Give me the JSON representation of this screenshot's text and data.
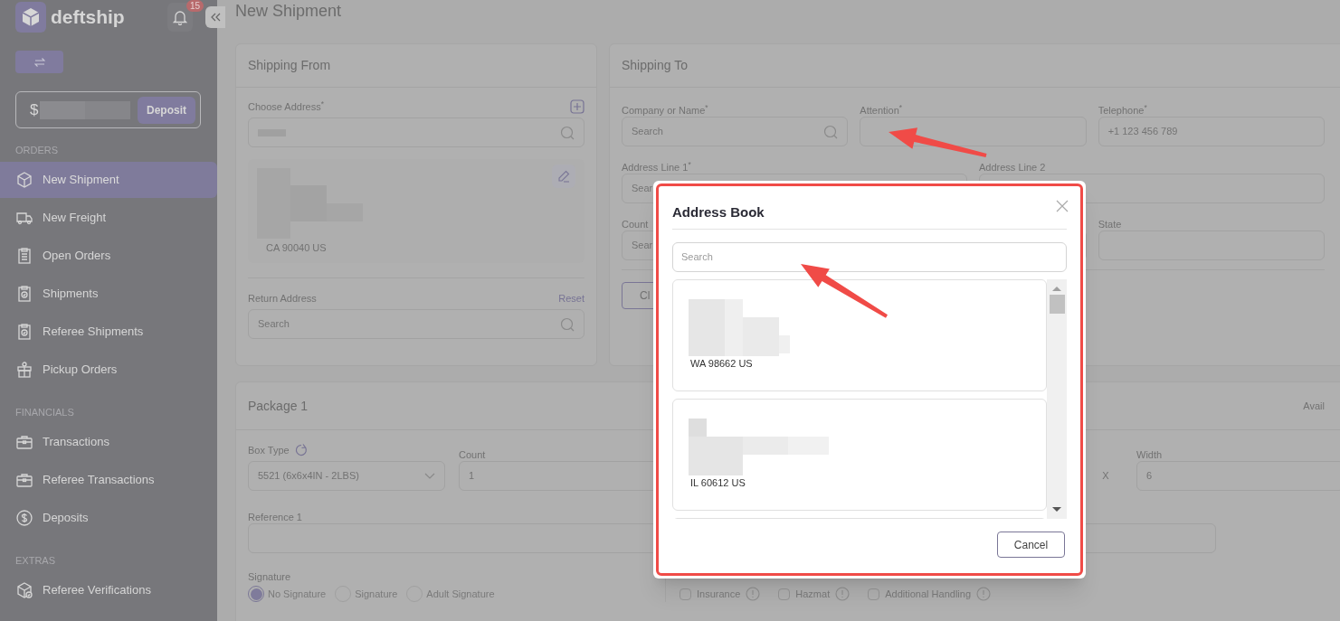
{
  "brand": {
    "name": "deftship",
    "notification_count": "15"
  },
  "balance": {
    "currency": "$",
    "deposit_button": "Deposit"
  },
  "sidebar": {
    "sections": [
      {
        "title": "ORDERS",
        "items": [
          {
            "label": "New Shipment",
            "selected": true
          },
          {
            "label": "New Freight",
            "selected": false
          },
          {
            "label": "Open Orders",
            "selected": false
          },
          {
            "label": "Shipments",
            "selected": false
          },
          {
            "label": "Referee Shipments",
            "selected": false
          },
          {
            "label": "Pickup Orders",
            "selected": false
          }
        ]
      },
      {
        "title": "FINANCIALS",
        "items": [
          {
            "label": "Transactions",
            "selected": false
          },
          {
            "label": "Referee Transactions",
            "selected": false
          },
          {
            "label": "Deposits",
            "selected": false
          }
        ]
      },
      {
        "title": "EXTRAS",
        "items": [
          {
            "label": "Referee Verifications",
            "selected": false
          }
        ]
      }
    ]
  },
  "page_title": "New Shipment",
  "shipping_from": {
    "title": "Shipping From",
    "choose_address_label": "Choose Address$^{*}$",
    "address_line": "CA 90040 US",
    "return_address_label": "Return Address",
    "reset_link": "Reset",
    "return_placeholder": "Search"
  },
  "shipping_to": {
    "title": "Shipping To",
    "rows": [
      [
        {
          "label": "Company or Name$^{*}$",
          "placeholder": "Search",
          "kind": "search"
        },
        {
          "label": "Attention$^{*}$",
          "kind": "text"
        },
        {
          "label": "Telephone$^{*}$",
          "placeholder": "+1 123 456 789",
          "kind": "text"
        }
      ],
      [
        {
          "label": "Address Line 1$^{*}$",
          "placeholder": "Sear",
          "kind": "wide"
        },
        {
          "label": "Address Line 2",
          "kind": "wide"
        }
      ],
      [
        {
          "label": "Count",
          "placeholder": "Sear",
          "kind": "text"
        },
        {
          "kind": "text"
        },
        {
          "label": "State",
          "kind": "text"
        }
      ]
    ],
    "button": "Cl"
  },
  "package": {
    "title": "Package 1",
    "right_text": "Avail",
    "box_type_label": "Box Type",
    "box_type_value": "5521 (6x6x4IN - 2LBS)",
    "count_label": "Count",
    "count_value": "1",
    "dimension_separator": "X",
    "width_label": "Width",
    "width_value": "6",
    "reference_label": "Reference 1",
    "signature_label": "Signature",
    "signature_options": [
      {
        "label": "No Signature",
        "selected": true
      },
      {
        "label": "Signature",
        "selected": false
      },
      {
        "label": "Adult Signature",
        "selected": false
      }
    ],
    "conditions": [
      {
        "label": "Insurance",
        "checked": false
      },
      {
        "label": "Hazmat",
        "checked": false
      },
      {
        "label": "Additional Handling",
        "checked": false
      }
    ]
  },
  "modal": {
    "title": "Address Book",
    "search_placeholder": "Search",
    "entries": [
      {
        "line": "WA 98662 US"
      },
      {
        "line": "IL 60612 US"
      }
    ],
    "cancel_button": "Cancel"
  }
}
